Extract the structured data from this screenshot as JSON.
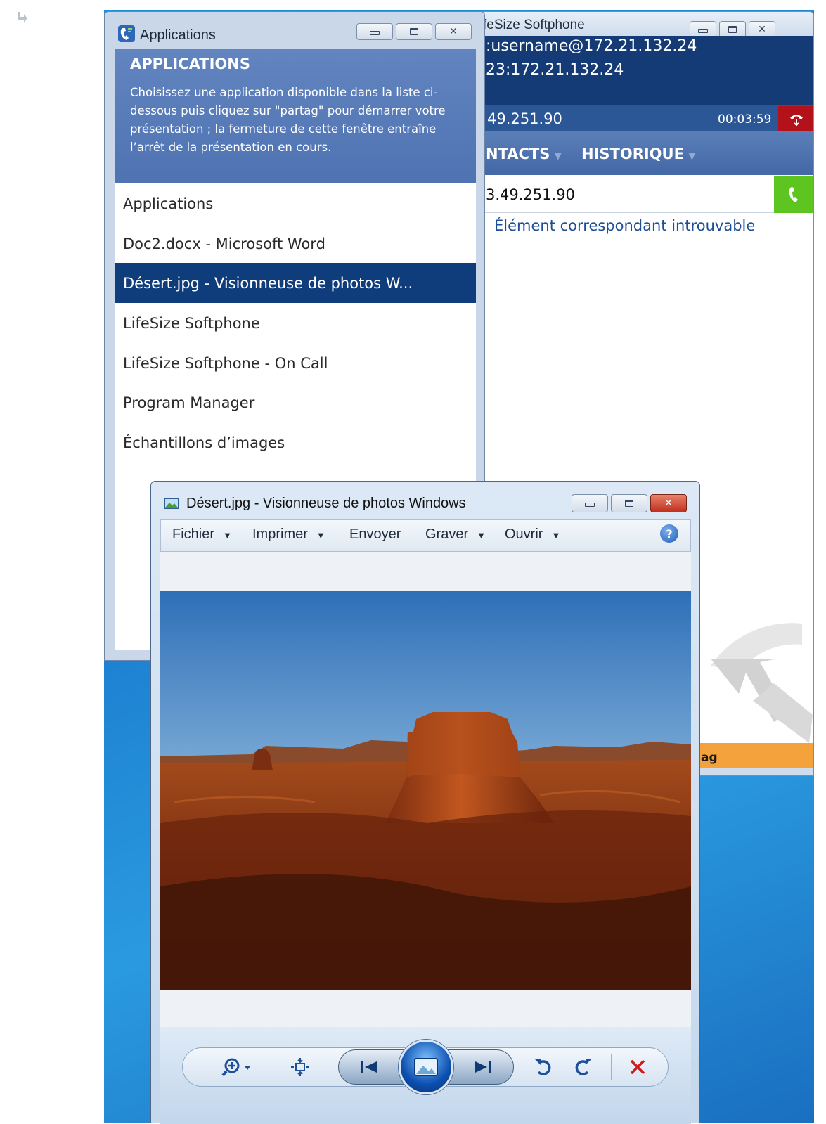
{
  "lifesize": {
    "title": "feSize Softphone",
    "line1": ":username@172.21.132.24",
    "line2": "23:172.21.132.24",
    "call_number": "49.251.90",
    "timer": "00:03:59",
    "tab_contacts": "NTACTS",
    "tab_history": "HISTORIQUE",
    "dial_value": "3.49.251.90",
    "no_match": "Élément correspondant introuvable",
    "share_label": "ag"
  },
  "applications": {
    "title": "Applications",
    "header_title": "APPLICATIONS",
    "header_desc": "Choisissez une application disponible dans la liste ci-dessous puis cliquez sur \"partag\" pour démarrer votre présentation ; la fermeture de cette fenêtre entraîne l’arrêt de la présentation en cours.",
    "items": [
      {
        "label": "Applications",
        "selected": false
      },
      {
        "label": "Doc2.docx - Microsoft Word",
        "selected": false
      },
      {
        "label": "Désert.jpg - Visionneuse de photos W...",
        "selected": true
      },
      {
        "label": "LifeSize Softphone",
        "selected": false
      },
      {
        "label": "LifeSize Softphone - On Call",
        "selected": false
      },
      {
        "label": "Program Manager",
        "selected": false
      },
      {
        "label": "Échantillons d’images",
        "selected": false
      }
    ]
  },
  "photo_viewer": {
    "title": "Désert.jpg - Visionneuse de photos Windows",
    "menu": {
      "fichier": "Fichier",
      "imprimer": "Imprimer",
      "envoyer": "Envoyer",
      "graver": "Graver",
      "ouvrir": "Ouvrir"
    },
    "help": "?"
  },
  "colors": {
    "selection": "#0f3d7c",
    "header_blue": "#143b76",
    "call_green": "#5ec41f",
    "hangup_red": "#b4121a",
    "share_orange": "#f4a23b"
  }
}
